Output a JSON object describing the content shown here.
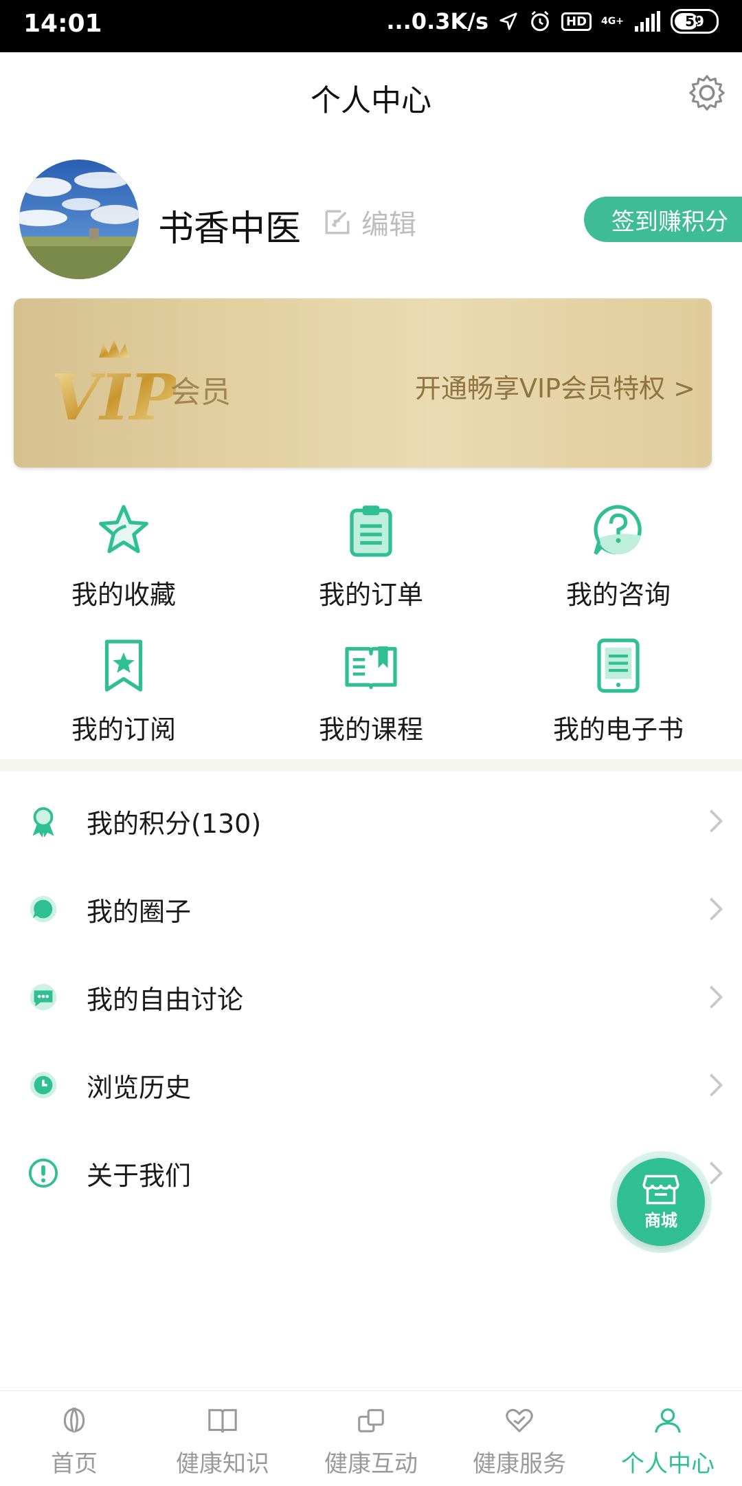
{
  "status_bar": {
    "time": "14:01",
    "speed": "...0.3K/s",
    "hd_badge": "HD",
    "network": "4G+",
    "battery": "59"
  },
  "header": {
    "title": "个人中心",
    "settings_icon": "gear-icon"
  },
  "profile": {
    "name": "书香中医",
    "edit_label": "编辑",
    "checkin_label": "签到赚积分"
  },
  "vip": {
    "logo_text": "VIP",
    "label": "会员",
    "cta": "开通畅享VIP会员特权 >"
  },
  "grid": [
    {
      "label": "我的收藏",
      "icon": "star-icon"
    },
    {
      "label": "我的订单",
      "icon": "clipboard-icon"
    },
    {
      "label": "我的咨询",
      "icon": "question-bubble-icon"
    },
    {
      "label": "我的订阅",
      "icon": "bookmark-star-icon"
    },
    {
      "label": "我的课程",
      "icon": "open-book-icon"
    },
    {
      "label": "我的电子书",
      "icon": "ebook-icon"
    }
  ],
  "list": [
    {
      "label": "我的积分(130)",
      "icon": "award-ribbon-icon"
    },
    {
      "label": "我的圈子",
      "icon": "chat-circle-icon"
    },
    {
      "label": "我的自由讨论",
      "icon": "chat-dots-icon"
    },
    {
      "label": "浏览历史",
      "icon": "clock-icon"
    },
    {
      "label": "关于我们",
      "icon": "info-exclamation-icon"
    }
  ],
  "fab": {
    "label": "商城",
    "icon": "store-icon"
  },
  "bottom_nav": [
    {
      "label": "首页",
      "icon": "home-leaf-icon",
      "active": false
    },
    {
      "label": "健康知识",
      "icon": "book-icon",
      "active": false
    },
    {
      "label": "健康互动",
      "icon": "interaction-icon",
      "active": false
    },
    {
      "label": "健康服务",
      "icon": "heart-hands-icon",
      "active": false
    },
    {
      "label": "个人中心",
      "icon": "user-icon",
      "active": true
    }
  ],
  "colors": {
    "accent": "#2fbf92",
    "checkin": "#3dbc95",
    "vip_text": "#8f7440",
    "inactive_nav": "#9a9a9a"
  }
}
